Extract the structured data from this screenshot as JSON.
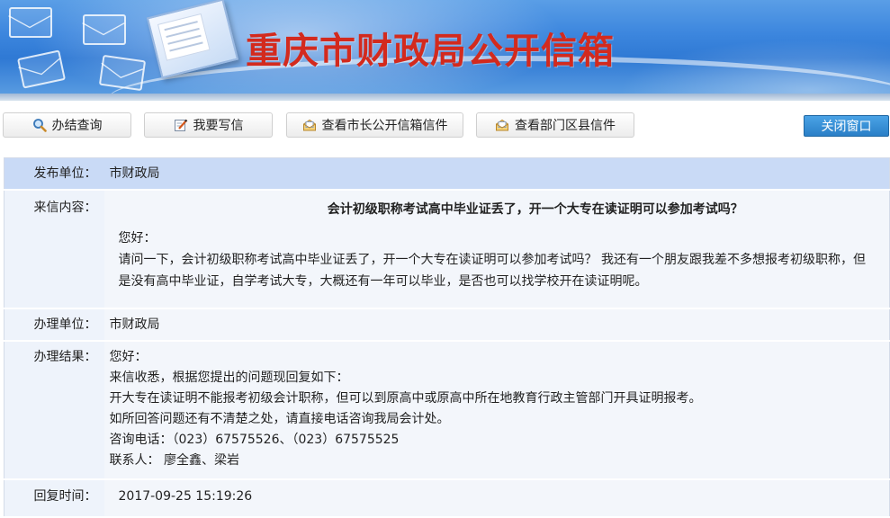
{
  "banner": {
    "title": "重庆市财政局公开信箱"
  },
  "toolbar": {
    "buttons": [
      {
        "label": "办结查询",
        "icon": "magnifier-icon"
      },
      {
        "label": "我要写信",
        "icon": "pencil-edit-icon"
      },
      {
        "label": "查看市长公开信箱信件",
        "icon": "open-envelope-icon"
      },
      {
        "label": "查看部门区县信件",
        "icon": "open-envelope-icon"
      }
    ],
    "close_label": "关闭窗口"
  },
  "detail": {
    "publisher": {
      "label": "发布单位：",
      "value": "市财政局"
    },
    "letter": {
      "label": "来信内容：",
      "title": "会计初级职称考试高中毕业证丢了，开一个大专在读证明可以参加考试吗？",
      "greeting": "您好：",
      "body": "请问一下，会计初级职称考试高中毕业证丢了，开一个大专在读证明可以参加考试吗？ 我还有一个朋友跟我差不多想报考初级职称，但是没有高中毕业证，自学考试大专，大概还有一年可以毕业，是否也可以找学校开在读证明呢。"
    },
    "handler": {
      "label": "办理单位：",
      "value": "市财政局"
    },
    "result": {
      "label": "办理结果：",
      "lines": [
        "您好：",
        "来信收悉，根据您提出的问题现回复如下：",
        "开大专在读证明不能报考初级会计职称，但可以到原高中或原高中所在地教育行政主管部门开具证明报考。",
        "如所回答问题还有不清楚之处，请直接电话咨询我局会计处。",
        "咨询电话：（023）67575526、（023）67575525",
        "联系人：  廖全鑫、梁岩"
      ]
    },
    "reply_time": {
      "label": "回复时间：",
      "value": "2017-09-25 15:19:26"
    }
  }
}
